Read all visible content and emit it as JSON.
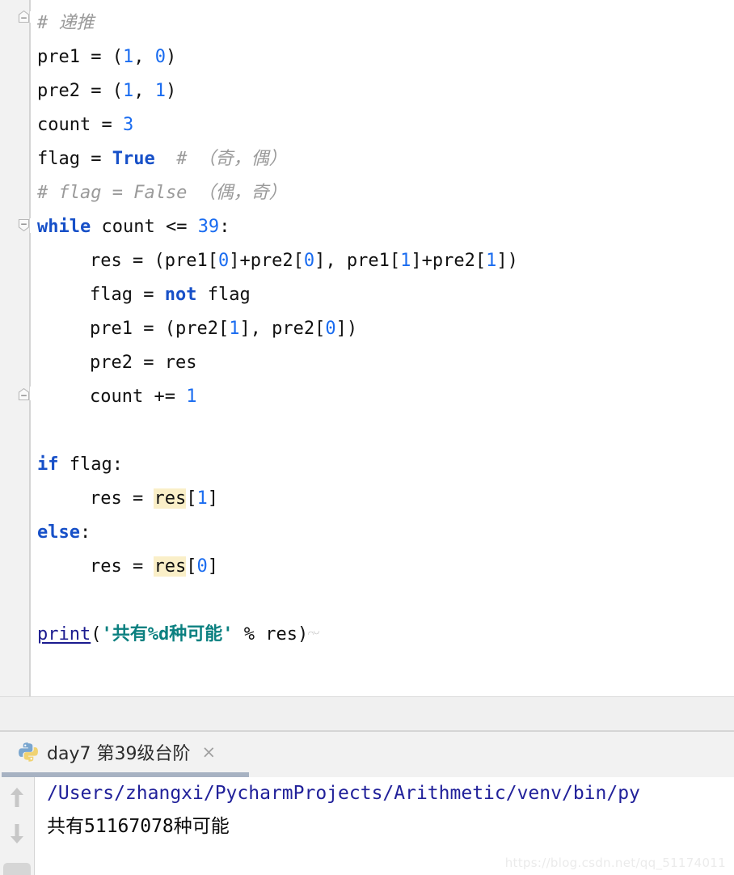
{
  "app": {
    "name": "PyCharm",
    "theme_background": "#ffffff",
    "gutter_background": "#f2f2f2"
  },
  "colors": {
    "keyword": "#1750c8",
    "number": "#1a6cf0",
    "comment": "#9a9a9a",
    "string": "#0b8080",
    "builtin": "#1b1b8f",
    "plain_text": "#111111",
    "identifier_highlight": "#faefc8",
    "console_path": "#21219a",
    "tab_underline": "#a7b2c2"
  },
  "editor": {
    "language": "Python",
    "font_size_px": 22,
    "lines": [
      {
        "n": 1,
        "indent": 0,
        "fold": "collapsible-start",
        "tokens": [
          {
            "t": "comment",
            "s": "# 递推"
          }
        ]
      },
      {
        "n": 2,
        "indent": 0,
        "tokens": [
          {
            "t": "plain",
            "s": "pre1 = ("
          },
          {
            "t": "number",
            "s": "1"
          },
          {
            "t": "plain",
            "s": ", "
          },
          {
            "t": "number",
            "s": "0"
          },
          {
            "t": "plain",
            "s": ")"
          }
        ]
      },
      {
        "n": 3,
        "indent": 0,
        "tokens": [
          {
            "t": "plain",
            "s": "pre2 = ("
          },
          {
            "t": "number",
            "s": "1"
          },
          {
            "t": "plain",
            "s": ", "
          },
          {
            "t": "number",
            "s": "1"
          },
          {
            "t": "plain",
            "s": ")"
          }
        ]
      },
      {
        "n": 4,
        "indent": 0,
        "tokens": [
          {
            "t": "plain",
            "s": "count = "
          },
          {
            "t": "number",
            "s": "3"
          }
        ]
      },
      {
        "n": 5,
        "indent": 0,
        "tokens": [
          {
            "t": "plain",
            "s": "flag = "
          },
          {
            "t": "keyword",
            "s": "True"
          },
          {
            "t": "comment",
            "s": "  # （奇，偶）"
          }
        ]
      },
      {
        "n": 6,
        "indent": 0,
        "tokens": [
          {
            "t": "comment",
            "s": "# flag = False （偶，奇）"
          }
        ]
      },
      {
        "n": 7,
        "indent": 0,
        "fold": "expanded-start",
        "tokens": [
          {
            "t": "keyword",
            "s": "while"
          },
          {
            "t": "plain",
            "s": " count <= "
          },
          {
            "t": "number",
            "s": "39"
          },
          {
            "t": "plain",
            "s": ":"
          }
        ]
      },
      {
        "n": 8,
        "indent": 1,
        "tokens": [
          {
            "t": "plain",
            "s": "res = (pre1["
          },
          {
            "t": "number",
            "s": "0"
          },
          {
            "t": "plain",
            "s": "]+pre2["
          },
          {
            "t": "number",
            "s": "0"
          },
          {
            "t": "plain",
            "s": "], pre1["
          },
          {
            "t": "number",
            "s": "1"
          },
          {
            "t": "plain",
            "s": "]+pre2["
          },
          {
            "t": "number",
            "s": "1"
          },
          {
            "t": "plain",
            "s": "])"
          }
        ]
      },
      {
        "n": 9,
        "indent": 1,
        "tokens": [
          {
            "t": "plain",
            "s": "flag = "
          },
          {
            "t": "keyword",
            "s": "not"
          },
          {
            "t": "plain",
            "s": " flag"
          }
        ]
      },
      {
        "n": 10,
        "indent": 1,
        "tokens": [
          {
            "t": "plain",
            "s": "pre1 = (pre2["
          },
          {
            "t": "number",
            "s": "1"
          },
          {
            "t": "plain",
            "s": "], pre2["
          },
          {
            "t": "number",
            "s": "0"
          },
          {
            "t": "plain",
            "s": "])"
          }
        ]
      },
      {
        "n": 11,
        "indent": 1,
        "tokens": [
          {
            "t": "plain",
            "s": "pre2 = res"
          }
        ]
      },
      {
        "n": 12,
        "indent": 1,
        "fold": "expanded-end",
        "tokens": [
          {
            "t": "plain",
            "s": "count += "
          },
          {
            "t": "number",
            "s": "1"
          }
        ]
      },
      {
        "n": 13,
        "indent": 0,
        "tokens": []
      },
      {
        "n": 14,
        "indent": 0,
        "tokens": [
          {
            "t": "keyword",
            "s": "if"
          },
          {
            "t": "plain",
            "s": " flag:"
          }
        ]
      },
      {
        "n": 15,
        "indent": 1,
        "tokens": [
          {
            "t": "plain",
            "s": "res = "
          },
          {
            "t": "highlight",
            "s": "res"
          },
          {
            "t": "plain",
            "s": "["
          },
          {
            "t": "number",
            "s": "1"
          },
          {
            "t": "plain",
            "s": "]"
          }
        ]
      },
      {
        "n": 16,
        "indent": 0,
        "tokens": [
          {
            "t": "keyword",
            "s": "else"
          },
          {
            "t": "plain",
            "s": ":"
          }
        ]
      },
      {
        "n": 17,
        "indent": 1,
        "tokens": [
          {
            "t": "plain",
            "s": "res = "
          },
          {
            "t": "highlight",
            "s": "res"
          },
          {
            "t": "plain",
            "s": "["
          },
          {
            "t": "number",
            "s": "0"
          },
          {
            "t": "plain",
            "s": "]"
          }
        ]
      },
      {
        "n": 18,
        "indent": 0,
        "tokens": []
      },
      {
        "n": 19,
        "indent": 0,
        "tokens": [
          {
            "t": "builtin",
            "s": "print"
          },
          {
            "t": "plain",
            "s": "("
          },
          {
            "t": "string",
            "s": "'共有%d种可能'"
          },
          {
            "t": "plain",
            "s": " % res)"
          },
          {
            "t": "squiggle",
            "s": ""
          }
        ]
      }
    ]
  },
  "console": {
    "tab": {
      "icon": "python-logo-icon",
      "label": "day7 第39级台阶",
      "close_label": "×"
    },
    "gutter": {
      "up_arrow": "arrow-up-icon",
      "down_arrow": "arrow-down-icon"
    },
    "output": [
      {
        "kind": "path",
        "text": "/Users/zhangxi/PycharmProjects/Arithmetic/venv/bin/py"
      },
      {
        "kind": "text",
        "text": "共有51167078种可能"
      }
    ]
  },
  "watermark": {
    "text": "https://blog.csdn.net/qq_51174011"
  }
}
